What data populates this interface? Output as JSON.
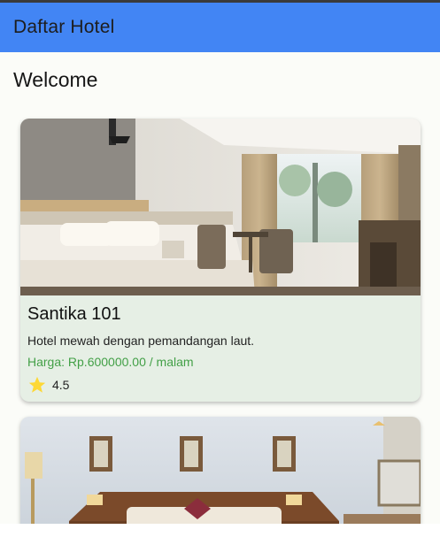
{
  "app_bar": {
    "title": "Daftar Hotel"
  },
  "page": {
    "heading": "Welcome"
  },
  "hotels": [
    {
      "name": "Santika 101",
      "description": "Hotel mewah dengan pemandangan laut.",
      "price": "Harga: Rp.600000.00 / malam",
      "rating": "4.5",
      "image": "hotel-room-photo"
    },
    {
      "image": "hotel-room-photo"
    }
  ],
  "colors": {
    "app_bar": "#4285f4",
    "card_background": "#e6efe5",
    "price_text": "#43a047",
    "star": "#fdd835"
  },
  "icons": {
    "rating": "star-icon"
  }
}
